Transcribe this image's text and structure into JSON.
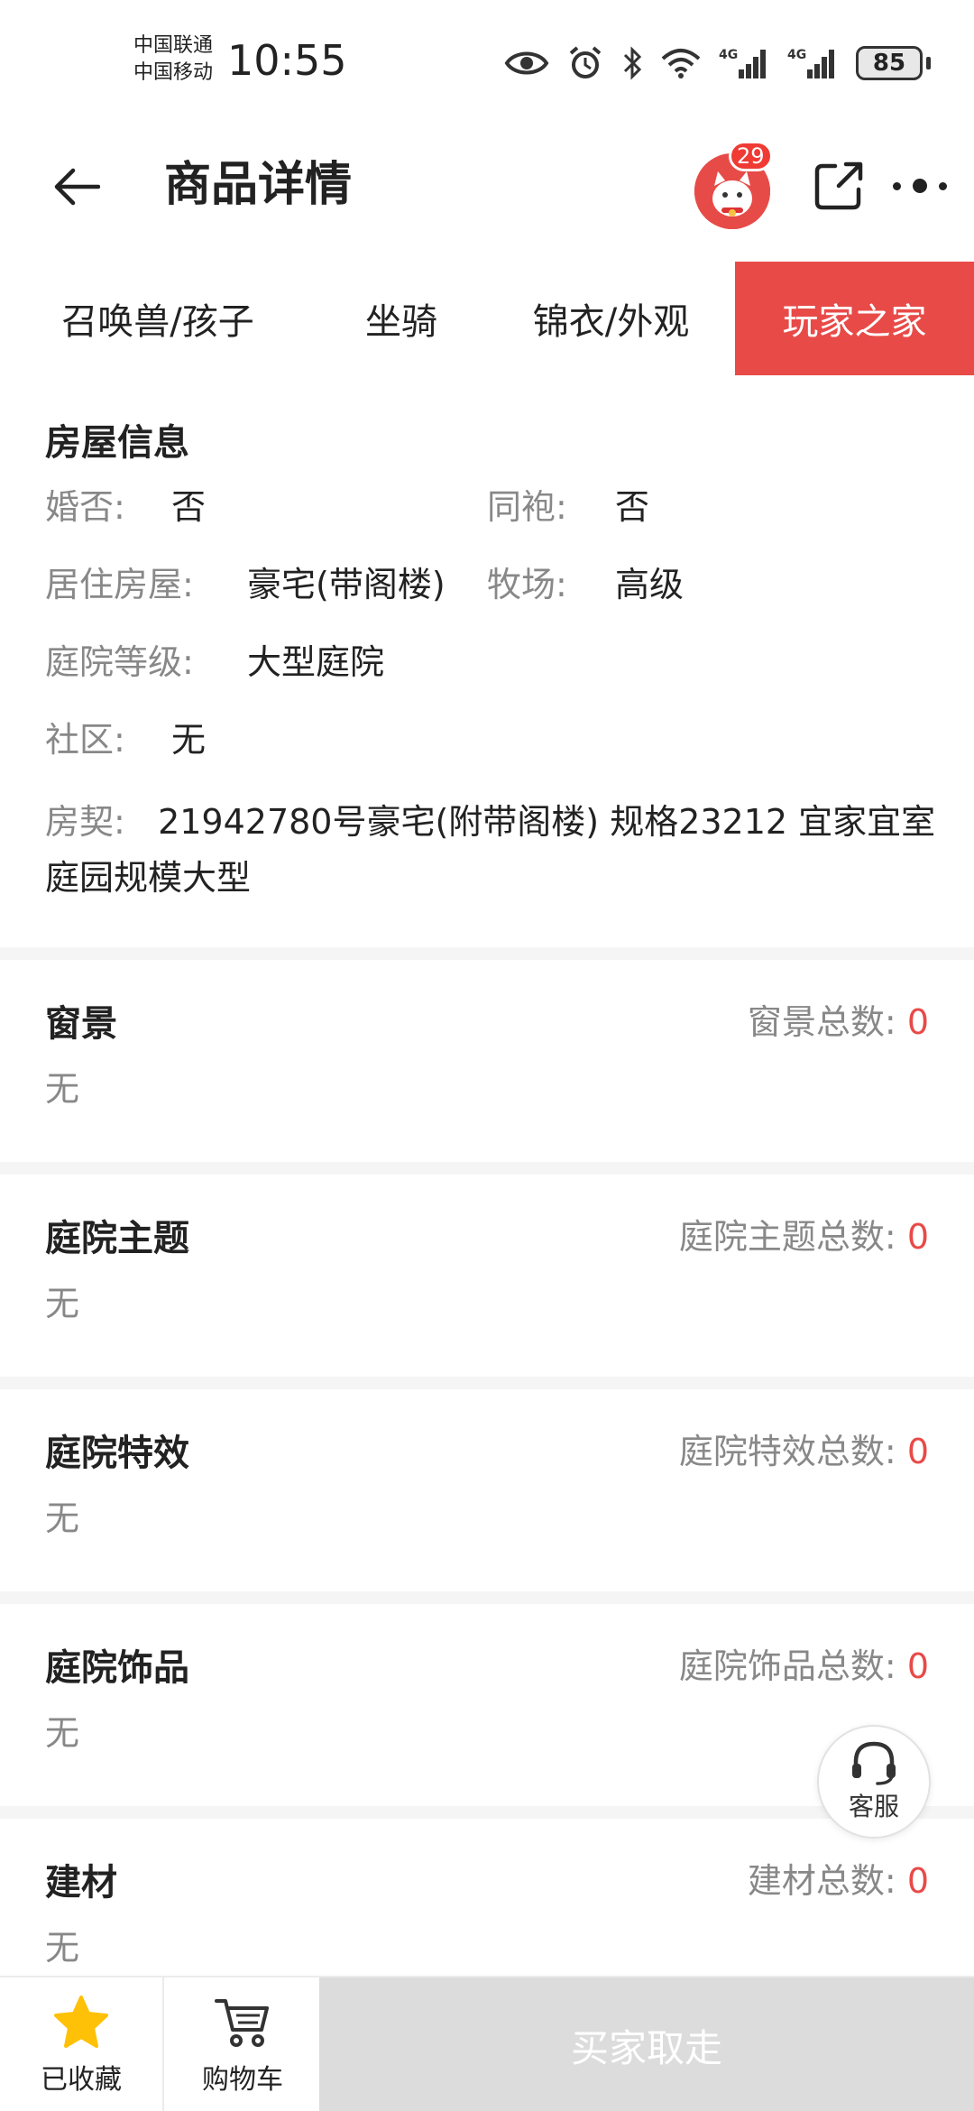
{
  "status_bar": {
    "carrier_1": "中国联通",
    "carrier_2": "中国移动",
    "time": "10:55",
    "network_1": "4G",
    "network_2": "4G",
    "battery": "85"
  },
  "header": {
    "title": "商品详情",
    "badge_count": "29"
  },
  "tabs": [
    {
      "label": "召唤兽/孩子",
      "active": false
    },
    {
      "label": "坐骑",
      "active": false
    },
    {
      "label": "锦衣/外观",
      "active": false
    },
    {
      "label": "玩家之家",
      "active": true
    }
  ],
  "house_info": {
    "title": "房屋信息",
    "married_label": "婚否:",
    "married_value": "否",
    "same_robe_label": "同袍:",
    "same_robe_value": "否",
    "residence_label": "居住房屋:",
    "residence_value": "豪宅(带阁楼)",
    "ranch_label": "牧场:",
    "ranch_value": "高级",
    "yard_level_label": "庭院等级:",
    "yard_level_value": "大型庭院",
    "community_label": "社区:",
    "community_value": "无",
    "deed_label": "房契:",
    "deed_value": "21942780号豪宅(附带阁楼) 规格23212 宜家宜室 庭园规模大型"
  },
  "sections": [
    {
      "title": "窗景",
      "count_label": "窗景总数:",
      "count": "0",
      "value": "无"
    },
    {
      "title": "庭院主题",
      "count_label": "庭院主题总数:",
      "count": "0",
      "value": "无"
    },
    {
      "title": "庭院特效",
      "count_label": "庭院特效总数:",
      "count": "0",
      "value": "无"
    },
    {
      "title": "庭院饰品",
      "count_label": "庭院饰品总数:",
      "count": "0",
      "value": "无"
    },
    {
      "title": "建材",
      "count_label": "建材总数:",
      "count": "0",
      "value": "无"
    }
  ],
  "floating": {
    "customer_service": "客服"
  },
  "bottom_bar": {
    "favorite_label": "已收藏",
    "cart_label": "购物车",
    "buy_label": "买家取走"
  },
  "colors": {
    "accent": "#e84a48",
    "star": "#ffc107",
    "disabled_button": "#dcdcdc"
  }
}
